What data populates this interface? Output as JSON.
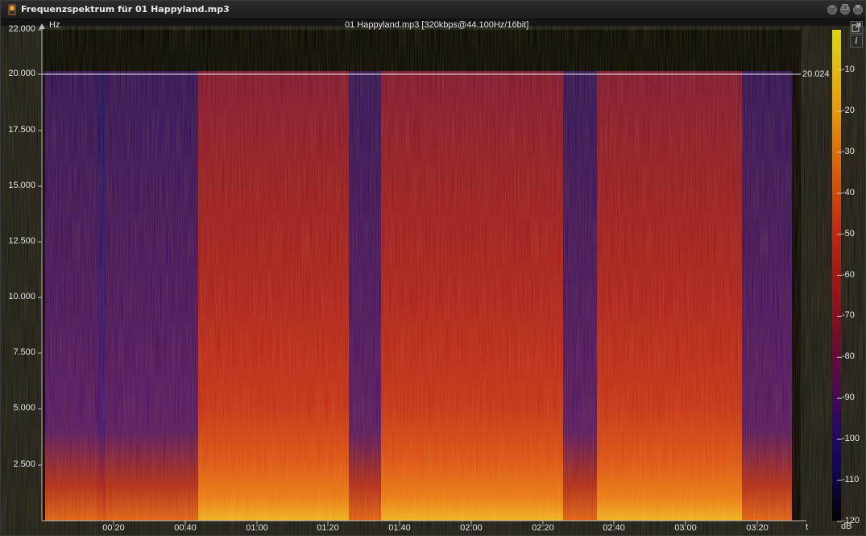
{
  "window": {
    "title": "Frequenzspektrum für 01 Happyland.mp3",
    "controls": [
      "minimize",
      "maximize",
      "close"
    ]
  },
  "plot": {
    "file_info": "01 Happyland.mp3 [320kbps@44.100Hz/16bit]",
    "y_unit": "Hz",
    "x_unit": "t",
    "y_ticks": [
      "22.000",
      "20.000",
      "17.500",
      "15.000",
      "12.500",
      "10.000",
      "7.500",
      "5.000",
      "2.500"
    ],
    "x_ticks": [
      "00:20",
      "00:40",
      "01:00",
      "01:20",
      "01:40",
      "02:00",
      "02:20",
      "02:40",
      "03:00",
      "03:20"
    ],
    "cutoff_marker": "20.024"
  },
  "colorbar": {
    "unit": "dB",
    "ticks": [
      "-10",
      "-20",
      "-30",
      "-40",
      "-50",
      "-60",
      "-70",
      "-80",
      "-90",
      "-100",
      "-110",
      "-120"
    ],
    "colors": [
      "#d8d400",
      "#e8a000",
      "#e86400",
      "#d63010",
      "#b01810",
      "#8a0c18",
      "#6a0830",
      "#4a0850",
      "#2a0868",
      "#140660",
      "#0a0430",
      "#000000"
    ]
  },
  "tools": {
    "export_icon": "export-icon",
    "info_label": "i"
  }
}
